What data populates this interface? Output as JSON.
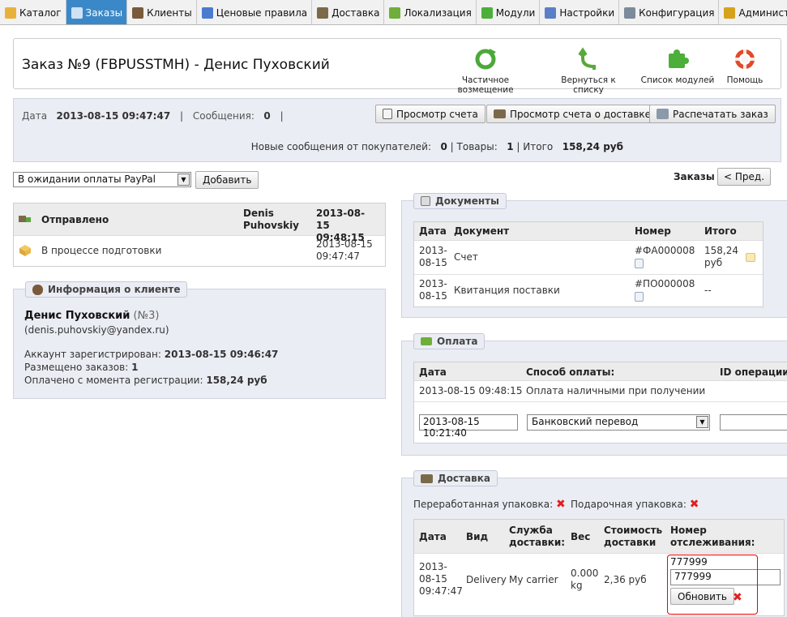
{
  "tabs": [
    {
      "label": "Каталог",
      "icon": "folder-icon",
      "color": "#e8b23a"
    },
    {
      "label": "Заказы",
      "icon": "cart-icon",
      "color": "#cfe1f3",
      "active": true
    },
    {
      "label": "Клиенты",
      "icon": "user-icon",
      "color": "#7a5a3a"
    },
    {
      "label": "Ценовые правила",
      "icon": "price-rules-icon",
      "color": "#4b7bd0"
    },
    {
      "label": "Доставка",
      "icon": "truck-icon",
      "color": "#7b6a4a"
    },
    {
      "label": "Локализация",
      "icon": "globe-icon",
      "color": "#6fae3a"
    },
    {
      "label": "Модули",
      "icon": "puzzle-icon",
      "color": "#4caf3a"
    },
    {
      "label": "Настройки",
      "icon": "settings-icon",
      "color": "#5a7fc7"
    },
    {
      "label": "Конфигурация",
      "icon": "wrench-icon",
      "color": "#7c8a9a"
    },
    {
      "label": "Администрация",
      "icon": "key-icon",
      "color": "#d6a21c"
    },
    {
      "label": "",
      "icon": "stats-icon",
      "color": "#5c8ad0"
    }
  ],
  "header": {
    "title": "Заказ №9 (FBPUSSTMH) - Денис Пуховский",
    "buttons": [
      {
        "label": "Частичное возмещение",
        "icon": "refund-icon",
        "color": "#4ca83a"
      },
      {
        "label": "Вернуться к списку",
        "icon": "back-icon",
        "color": "#5aa83a"
      },
      {
        "label": "Список модулей",
        "icon": "modules-list-icon",
        "color": "#4caf3a"
      },
      {
        "label": "Помощь",
        "icon": "help-icon",
        "color": "#e04a2a"
      }
    ]
  },
  "info": {
    "date_label": "Дата",
    "date_value": "2013-08-15 09:47:47",
    "sep": "|",
    "messages_label": "Сообщения:",
    "messages_value": "0",
    "btn_invoice": "Просмотр счета",
    "btn_delivery": "Просмотр счета о доставке",
    "btn_print": "Распечатать заказ",
    "new_messages_label": "Новые сообщения от покупателей:",
    "new_messages_value": "0",
    "goods_label": "Товары:",
    "goods_value": "1",
    "total_label": "Итого",
    "total_value": "158,24 руб"
  },
  "status_select": {
    "value": "В ожидании оплаты PayPal",
    "add_label": "Добавить"
  },
  "orders_nav": {
    "label": "Заказы :",
    "prev_label": "< Пред."
  },
  "history": [
    {
      "status": "Отправлено",
      "user": "Denis Puhovskiy",
      "date": "2013-08-15 09:48:15",
      "bold": true
    },
    {
      "status": "В процессе подготовки",
      "user": "",
      "date": "2013-08-15 09:47:47",
      "bold": false
    }
  ],
  "customer": {
    "legend": "Информация о клиенте",
    "name": "Денис Пуховский",
    "number": "(№3)",
    "email": "(denis.puhovskiy@yandex.ru)",
    "registered_label": "Аккаунт зарегистрирован:",
    "registered_value": "2013-08-15 09:46:47",
    "orders_label": "Размещено заказов:",
    "orders_value": "1",
    "paid_label": "Оплачено с момента регистрации:",
    "paid_value": "158,24 руб"
  },
  "documents": {
    "legend": "Документы",
    "headers": [
      "Дата",
      "Документ",
      "Номер",
      "Итого"
    ],
    "rows": [
      {
        "date": "2013-08-15",
        "doc": "Счет",
        "number": "#ФА000008",
        "total": "158,24 руб"
      },
      {
        "date": "2013-08-15",
        "doc": "Квитанция поставки",
        "number": "#ПО000008",
        "total": "--"
      }
    ]
  },
  "payment": {
    "legend": "Оплата",
    "headers": [
      "Дата",
      "Способ оплаты:",
      "ID операции"
    ],
    "row": {
      "date": "2013-08-15 09:48:15",
      "method": "Оплата наличными при получении"
    },
    "new_date": "2013-08-15 10:21:40",
    "new_method": "Банковский перевод"
  },
  "shipping": {
    "legend": "Доставка",
    "recycled_label": "Переработанная упаковка:",
    "gift_label": "Подарочная упаковка:",
    "headers": [
      "Дата",
      "Вид",
      "Служба доставки:",
      "Вес",
      "Стоимость доставки",
      "Номер отслеживания:"
    ],
    "row": {
      "date": "2013-08-15 09:47:47",
      "type": "Delivery",
      "carrier": "My carrier",
      "weight": "0.000 kg",
      "cost": "2,36 руб",
      "tracking": "777999"
    },
    "tracking_input": "777999",
    "update_label": "Обновить"
  }
}
